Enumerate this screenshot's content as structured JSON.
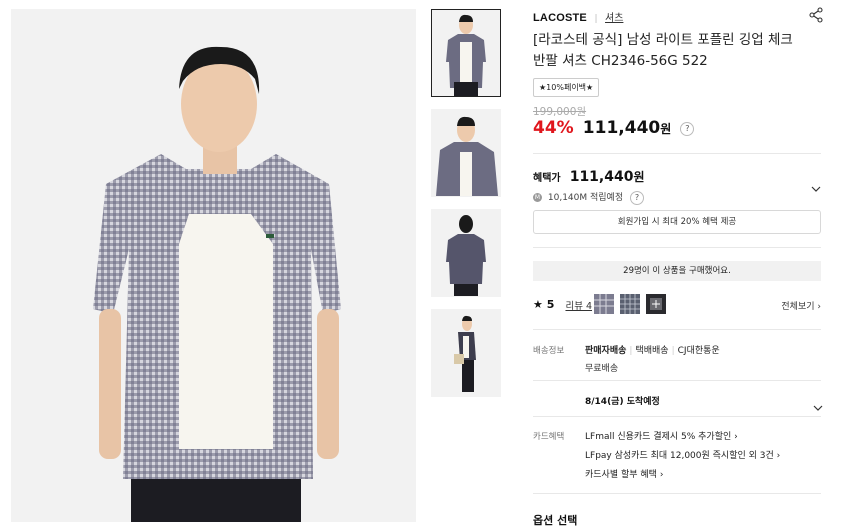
{
  "brand": "LACOSTE",
  "category": "셔츠",
  "title": "[라코스테 공식] 남성 라이트 포플린 깅업 체크 반팔 셔츠 CH2346-56G 522",
  "tag": "★10%페이백★",
  "price": {
    "original": "199,000원",
    "discount": "44%",
    "sale": "111,440",
    "unit": "원",
    "help_icon": "?"
  },
  "benefit": {
    "label": "혜택가",
    "price": "111,440",
    "unit": "원",
    "points_badge": "M",
    "points": "10,140M 적립예정",
    "help_icon": "?"
  },
  "membership_text": "회원가입 시 최대 20% 혜택 제공",
  "purchase_notice": "29명이 이 상품을 구매했어요.",
  "reviews": {
    "star": "★",
    "rating": "5",
    "link": "리뷰 4",
    "view_all": "전체보기 ›"
  },
  "shipping": {
    "label": "배송정보",
    "options": [
      "판매자배송",
      "택배배송",
      "CJ대한통운"
    ],
    "free": "무료배송",
    "arrival": "8/14(금) 도착예정"
  },
  "card": {
    "label": "카드혜택",
    "line1": "LFmall 신용카드 결제시 5% 추가할인 ›",
    "line2": "LFpay 삼성카드 최대 12,000원 즉시할인 외 3건 ›",
    "line3": "카드사별 할부 혜택 ›"
  },
  "option_title": "옵션 선택",
  "icons": {
    "share": "share-icon",
    "expand": "chevron-down-icon"
  },
  "colors": {
    "discount": "#e0161d",
    "shirt_check": "#4a4a5e",
    "divider": "#e8e8e8"
  }
}
